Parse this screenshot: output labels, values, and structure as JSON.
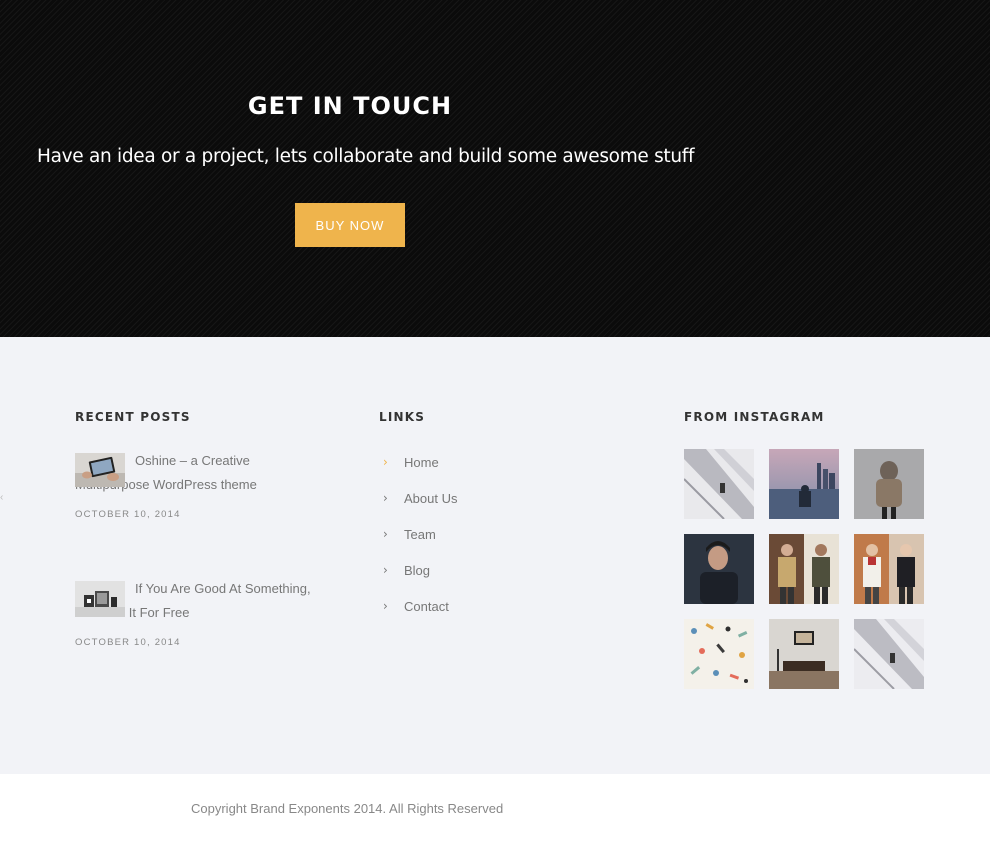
{
  "hero": {
    "title": "GET IN TOUCH",
    "subtitle": "Have an idea or a project, lets collaborate and build some awesome stuff",
    "button_label": "BUY NOW",
    "accent_color": "#efb44c"
  },
  "recent_posts": {
    "title": "RECENT POSTS",
    "posts": [
      {
        "title": "Oshine – a Creative Multipurpose WordPress theme",
        "date": "OCTOBER 10, 2014",
        "thumb": "tablet-photo"
      },
      {
        "title": "If You Are Good At Something, Don't Do It For Free",
        "date": "OCTOBER 10, 2014",
        "thumb": "devices-photo"
      }
    ]
  },
  "links": {
    "title": "LINKS",
    "items": [
      {
        "label": "Home",
        "icon": "chevron-right-icon"
      },
      {
        "label": "About Us",
        "icon": "chevron-right-icon"
      },
      {
        "label": "Team",
        "icon": "chevron-right-icon"
      },
      {
        "label": "Blog",
        "icon": "chevron-right-icon"
      },
      {
        "label": "Contact",
        "icon": "chevron-right-icon"
      }
    ]
  },
  "instagram": {
    "title": "FROM INSTAGRAM",
    "images": [
      "staircase",
      "city-lake",
      "hooded-figure",
      "man-portrait",
      "two-men",
      "two-men-color",
      "pattern",
      "interior-room",
      "staircase"
    ]
  },
  "footer": {
    "copyright": "Copyright Brand Exponents 2014. All Rights Reserved"
  }
}
